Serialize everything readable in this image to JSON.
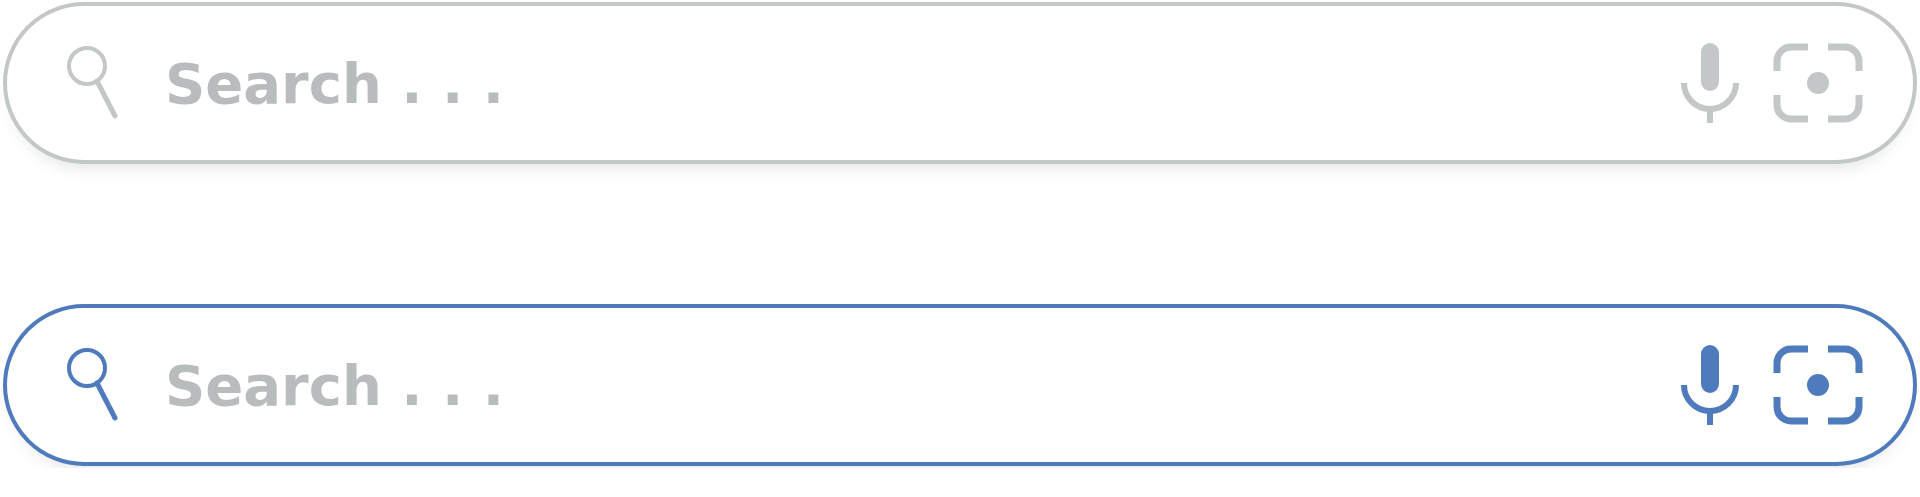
{
  "search_bars": [
    {
      "placeholder": "Search . . .",
      "focused": false
    },
    {
      "placeholder": "Search . . .",
      "focused": true
    }
  ]
}
